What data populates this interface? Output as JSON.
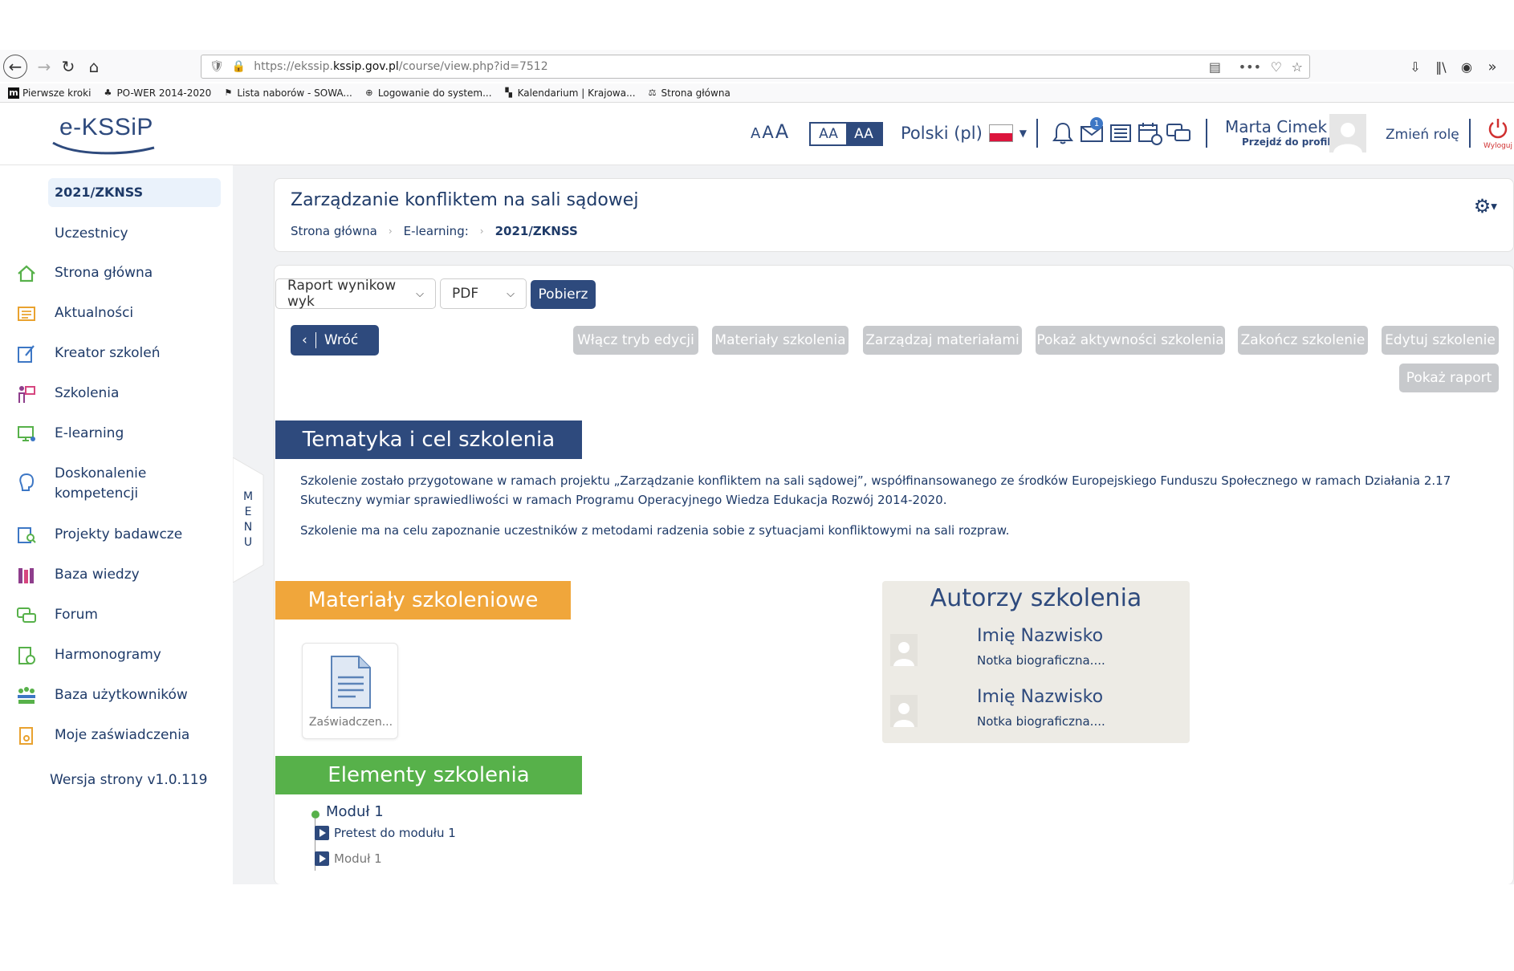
{
  "browser": {
    "url_prefix": "https://ekssip.",
    "url_domain": "kssip.gov.pl",
    "url_path": "/course/view.php?id=7512",
    "bookmarks": [
      {
        "label": "Pierwsze kroki",
        "icon": "mozilla-icon"
      },
      {
        "label": "PO-WER 2014-2020",
        "icon": "tree-icon"
      },
      {
        "label": "Lista naborów - SOWA...",
        "icon": "sowa-icon"
      },
      {
        "label": "Logowanie do system...",
        "icon": "globe-icon"
      },
      {
        "label": "Kalendarium | Krajowa...",
        "icon": "kssip-icon"
      },
      {
        "label": "Strona główna",
        "icon": "scales-icon"
      }
    ]
  },
  "header": {
    "logo_text": "e-KSSiP",
    "font_size_label": "AAA",
    "contrast_options": [
      "AA",
      "AA"
    ],
    "language": "Polski (pl)",
    "notification_count": "1",
    "user_name": "Marta Cimek",
    "profile_link": "Przejdź do profilu",
    "change_role": "Zmień rolę",
    "logout": "Wyloguj",
    "accent": "#2e4a7d"
  },
  "sidebar": {
    "course_code": "2021/ZKNSS",
    "participants": "Uczestnicy",
    "items": [
      {
        "label": "Strona główna",
        "icon": "home-icon"
      },
      {
        "label": "Aktualności",
        "icon": "newspaper-icon"
      },
      {
        "label": "Kreator szkoleń",
        "icon": "edit-icon"
      },
      {
        "label": "Szkolenia",
        "icon": "presentation-icon"
      },
      {
        "label": "E-learning",
        "icon": "monitor-icon"
      },
      {
        "label": "Doskonalenie kompetencji",
        "icon": "brain-icon"
      },
      {
        "label": "Projekty badawcze",
        "icon": "research-icon"
      },
      {
        "label": "Baza wiedzy",
        "icon": "books-icon"
      },
      {
        "label": "Forum",
        "icon": "chat-icon"
      },
      {
        "label": "Harmonogramy",
        "icon": "schedule-icon"
      },
      {
        "label": "Baza użytkowników",
        "icon": "users-icon"
      },
      {
        "label": "Moje zaświadczenia",
        "icon": "certificate-icon"
      }
    ],
    "menu_tab_letters": [
      "M",
      "E",
      "N",
      "U"
    ],
    "version": "Wersja strony v1.0.119"
  },
  "page": {
    "title": "Zarządzanie konfliktem na sali sądowej",
    "breadcrumb": [
      "Strona główna",
      "E-learning:",
      "2021/ZKNSS"
    ]
  },
  "toolbar": {
    "report_select": "Raport wynikow wyk",
    "format_select": "PDF",
    "download": "Pobierz",
    "back": "Wróć",
    "buttons": [
      "Włącz tryb edycji",
      "Materiały szkolenia",
      "Zarządzaj materiałami",
      "Pokaż aktywności szkolenia",
      "Zakończ szkolenie",
      "Edytuj szkolenie",
      "Pokaż raport"
    ]
  },
  "sections": {
    "about_title": "Tematyka i cel szkolenia",
    "about_color": "#2e4a7d",
    "about_paragraphs": [
      "Szkolenie zostało przygotowane w ramach projektu „Zarządzanie konfliktem na sali sądowej”, współfinansowanego ze środków Europejskiego Funduszu Społecznego w ramach Działania 2.17 Skuteczny wymiar sprawiedliwości w ramach Programu Operacyjnego Wiedza Edukacja Rozwój 2014-2020.",
      "Szkolenie ma na celu zapoznanie uczestników z metodami radzenia sobie z sytuacjami konfliktowymi na sali rozpraw."
    ],
    "materials_title": "Materiały szkoleniowe",
    "materials_color": "#f0a63b",
    "material_file": "Zaświadczen...",
    "authors_title": "Autorzy szkolenia",
    "authors": [
      {
        "name": "Imię Nazwisko",
        "bio": "Notka biograficzna...."
      },
      {
        "name": "Imię Nazwisko",
        "bio": "Notka biograficzna...."
      }
    ],
    "elements_title": "Elementy szkolenia",
    "elements_color": "#57b14a",
    "module_title": "Moduł 1",
    "module_items": [
      "Pretest do modułu 1",
      "Moduł 1"
    ]
  }
}
